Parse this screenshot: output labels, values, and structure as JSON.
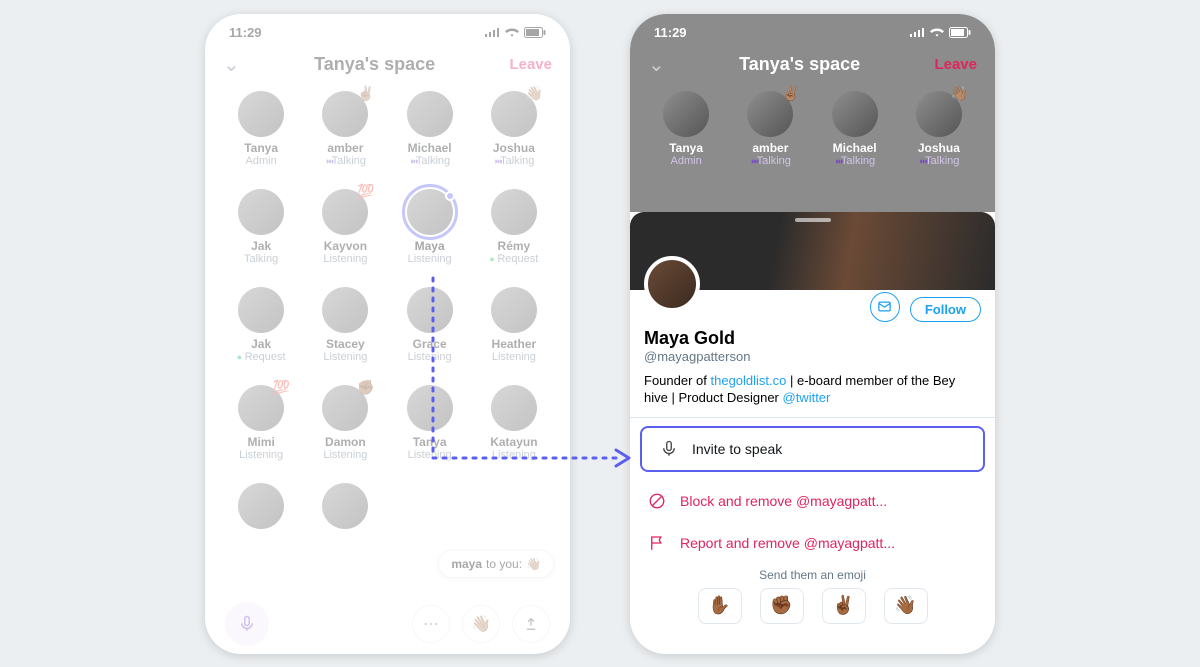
{
  "statusbar": {
    "time": "11:29"
  },
  "header": {
    "title": "Tanya's space",
    "leave": "Leave"
  },
  "rows": [
    [
      {
        "name": "Tanya",
        "status": "Admin",
        "cls": "",
        "badge": ""
      },
      {
        "name": "amber",
        "status": "Talking",
        "cls": "talking",
        "badge": "✌🏽"
      },
      {
        "name": "Michael",
        "status": "Talking",
        "cls": "talking",
        "badge": ""
      },
      {
        "name": "Joshua",
        "status": "Talking",
        "cls": "talking",
        "badge": "👋🏽"
      }
    ],
    [
      {
        "name": "Jak",
        "status": "Talking",
        "cls": "",
        "badge": ""
      },
      {
        "name": "Kayvon",
        "status": "Listening",
        "cls": "",
        "badge": "💯"
      },
      {
        "name": "Maya",
        "status": "Listening",
        "cls": "",
        "badge": "",
        "maya": true
      },
      {
        "name": "Rémy",
        "status": "Request",
        "cls": "request",
        "badge": ""
      }
    ],
    [
      {
        "name": "Jak",
        "status": "Request",
        "cls": "request",
        "badge": ""
      },
      {
        "name": "Stacey",
        "status": "Listening",
        "cls": "",
        "badge": ""
      },
      {
        "name": "Grace",
        "status": "Listening",
        "cls": "",
        "badge": ""
      },
      {
        "name": "Heather",
        "status": "Listening",
        "cls": "",
        "badge": ""
      }
    ],
    [
      {
        "name": "Mimi",
        "status": "Listening",
        "cls": "",
        "badge": "💯"
      },
      {
        "name": "Damon",
        "status": "Listening",
        "cls": "",
        "badge": "✊🏾"
      },
      {
        "name": "Tanya",
        "status": "Listening",
        "cls": "",
        "badge": ""
      },
      {
        "name": "Katayun",
        "status": "Listening",
        "cls": "",
        "badge": ""
      }
    ]
  ],
  "toast": {
    "from": "maya",
    "to": " to you:",
    "emoji": "👋🏽"
  },
  "profile": {
    "name": "Maya Gold",
    "handle": "@mayagpatterson",
    "bio_pre": "Founder of ",
    "bio_link1": "thegoldlist.co",
    "bio_mid": " | e-board member of the Bey hive | Product Designer ",
    "bio_link2": "@twitter",
    "follow": "Follow",
    "invite": "Invite to speak",
    "block": "Block and remove @mayagpatt...",
    "report": "Report and remove @mayagpatt...",
    "send": "Send them an emoji",
    "emojis": [
      "✋🏾",
      "✊🏾",
      "✌🏾",
      "👋🏾"
    ]
  }
}
